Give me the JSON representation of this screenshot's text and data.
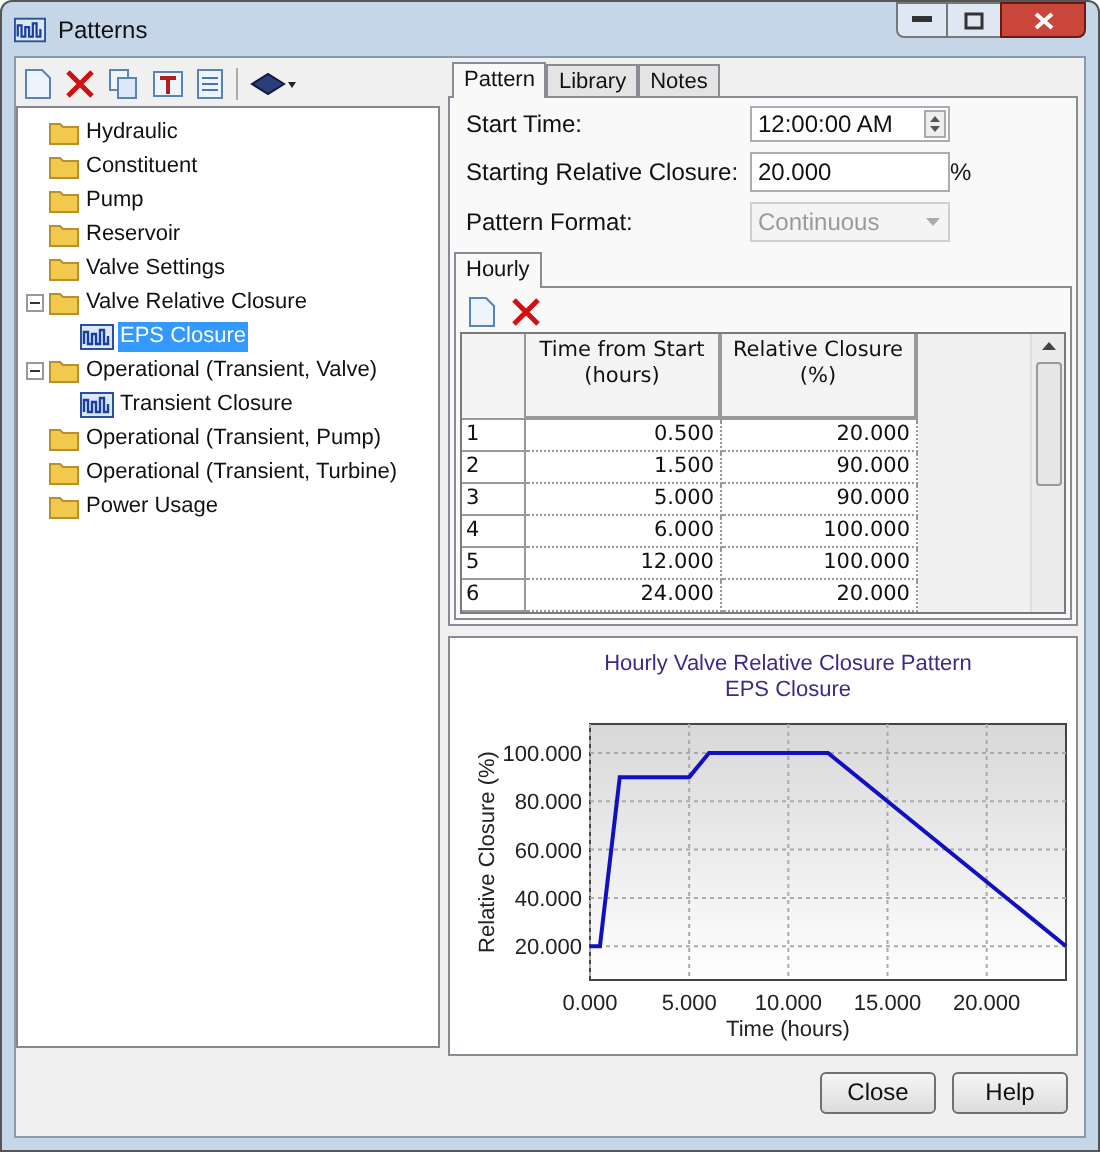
{
  "window": {
    "title": "Patterns"
  },
  "tree": [
    {
      "label": "Hydraulic",
      "kind": "folder",
      "selected": false
    },
    {
      "label": "Constituent",
      "kind": "folder",
      "selected": false
    },
    {
      "label": "Pump",
      "kind": "folder",
      "selected": false
    },
    {
      "label": "Reservoir",
      "kind": "folder",
      "selected": false
    },
    {
      "label": "Valve Settings",
      "kind": "folder",
      "selected": false
    },
    {
      "label": "Valve Relative Closure",
      "kind": "folder",
      "selected": false,
      "expanded": true,
      "children": [
        {
          "label": "EPS Closure",
          "kind": "pattern",
          "selected": true
        }
      ]
    },
    {
      "label": "Operational (Transient, Valve)",
      "kind": "folder",
      "selected": false,
      "expanded": true,
      "children": [
        {
          "label": "Transient Closure",
          "kind": "pattern",
          "selected": false
        }
      ]
    },
    {
      "label": "Operational (Transient, Pump)",
      "kind": "folder",
      "selected": false
    },
    {
      "label": "Operational (Transient, Turbine)",
      "kind": "folder",
      "selected": false
    },
    {
      "label": "Power Usage",
      "kind": "folder",
      "selected": false
    }
  ],
  "tabs": [
    {
      "label": "Pattern",
      "selected": true
    },
    {
      "label": "Library",
      "selected": false
    },
    {
      "label": "Notes",
      "selected": false
    }
  ],
  "fields": {
    "start_time": {
      "label": "Start Time:",
      "value": "12:00:00 AM"
    },
    "starting_relative_closure": {
      "label": "Starting Relative Closure:",
      "value": "20.000",
      "unit": "%"
    },
    "pattern_format": {
      "label": "Pattern Format:",
      "value": "Continuous",
      "disabled": true
    }
  },
  "sub_tabs": [
    {
      "label": "Hourly",
      "selected": true
    }
  ],
  "table": {
    "columns": [
      "Time from Start\n(hours)",
      "Relative Closure\n(%)"
    ],
    "rows": [
      {
        "index": "1",
        "cells": [
          "0.500",
          "20.000"
        ]
      },
      {
        "index": "2",
        "cells": [
          "1.500",
          "90.000"
        ]
      },
      {
        "index": "3",
        "cells": [
          "5.000",
          "90.000"
        ]
      },
      {
        "index": "4",
        "cells": [
          "6.000",
          "100.000"
        ]
      },
      {
        "index": "5",
        "cells": [
          "12.000",
          "100.000"
        ]
      },
      {
        "index": "6",
        "cells": [
          "24.000",
          "20.000"
        ]
      }
    ]
  },
  "chart": {
    "chart_data": {
      "type": "line",
      "title": "Hourly Valve Relative Closure Pattern\nEPS Closure",
      "xlabel": "Time (hours)",
      "ylabel": "Relative Closure (%)",
      "x": [
        0,
        0.5,
        1.5,
        5,
        6,
        12,
        24
      ],
      "grid": true,
      "series": [
        {
          "color": "#1010c0",
          "values": [
            20,
            20,
            90,
            90,
            100,
            100,
            20
          ]
        }
      ],
      "xlim": [
        0,
        24
      ],
      "ylim": [
        6,
        112
      ],
      "xticks": [
        {
          "value": 0,
          "label": "0.000"
        },
        {
          "value": 5,
          "label": "5.000"
        },
        {
          "value": 10,
          "label": "10.000"
        },
        {
          "value": 15,
          "label": "15.000"
        },
        {
          "value": 20,
          "label": "20.000"
        }
      ],
      "yticks": [
        {
          "value": 20,
          "label": "20.000"
        },
        {
          "value": 40,
          "label": "40.000"
        },
        {
          "value": 60,
          "label": "60.000"
        },
        {
          "value": 80,
          "label": "80.000"
        },
        {
          "value": 100,
          "label": "100.000"
        }
      ]
    }
  },
  "buttons": [
    "Close",
    "Help"
  ]
}
